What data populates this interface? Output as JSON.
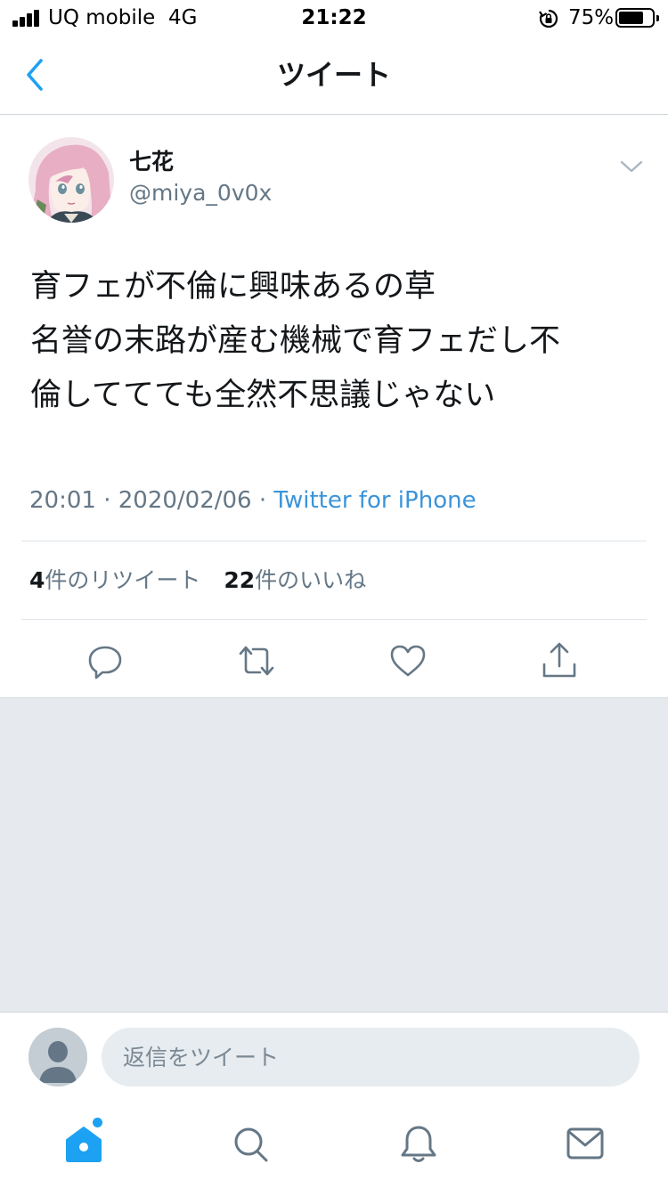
{
  "status_bar": {
    "carrier": "UQ mobile",
    "network": "4G",
    "time": "21:22",
    "battery_percent": "75%",
    "battery_level": 0.75,
    "signal_bars": 4
  },
  "nav": {
    "title": "ツイート",
    "back_icon": "chevron-left-icon"
  },
  "tweet": {
    "display_name": "七花",
    "handle": "@miya_0v0x",
    "text_lines": [
      "育フェが不倫に興味あるの草",
      "名誉の末路が産む機械で育フェだし不",
      "倫しててても全然不思議じゃない"
    ],
    "time": "20:01",
    "date": "2020/02/06",
    "separator": " · ",
    "source": "Twitter for iPhone",
    "retweets": {
      "count": "4",
      "label": "件のリツイート"
    },
    "likes": {
      "count": "22",
      "label": "件のいいね"
    }
  },
  "actions": [
    "reply-icon",
    "retweet-icon",
    "like-icon",
    "share-icon"
  ],
  "reply_bar": {
    "placeholder": "返信をツイート"
  },
  "tab_bar": [
    "home-icon",
    "search-icon",
    "notifications-icon",
    "messages-icon"
  ],
  "colors": {
    "accent": "#1da1f2",
    "link": "#3b94d9",
    "text_primary": "#14171a",
    "text_secondary": "#657786",
    "gray_area": "#e6e9ed",
    "icon_gray": "#657786"
  }
}
